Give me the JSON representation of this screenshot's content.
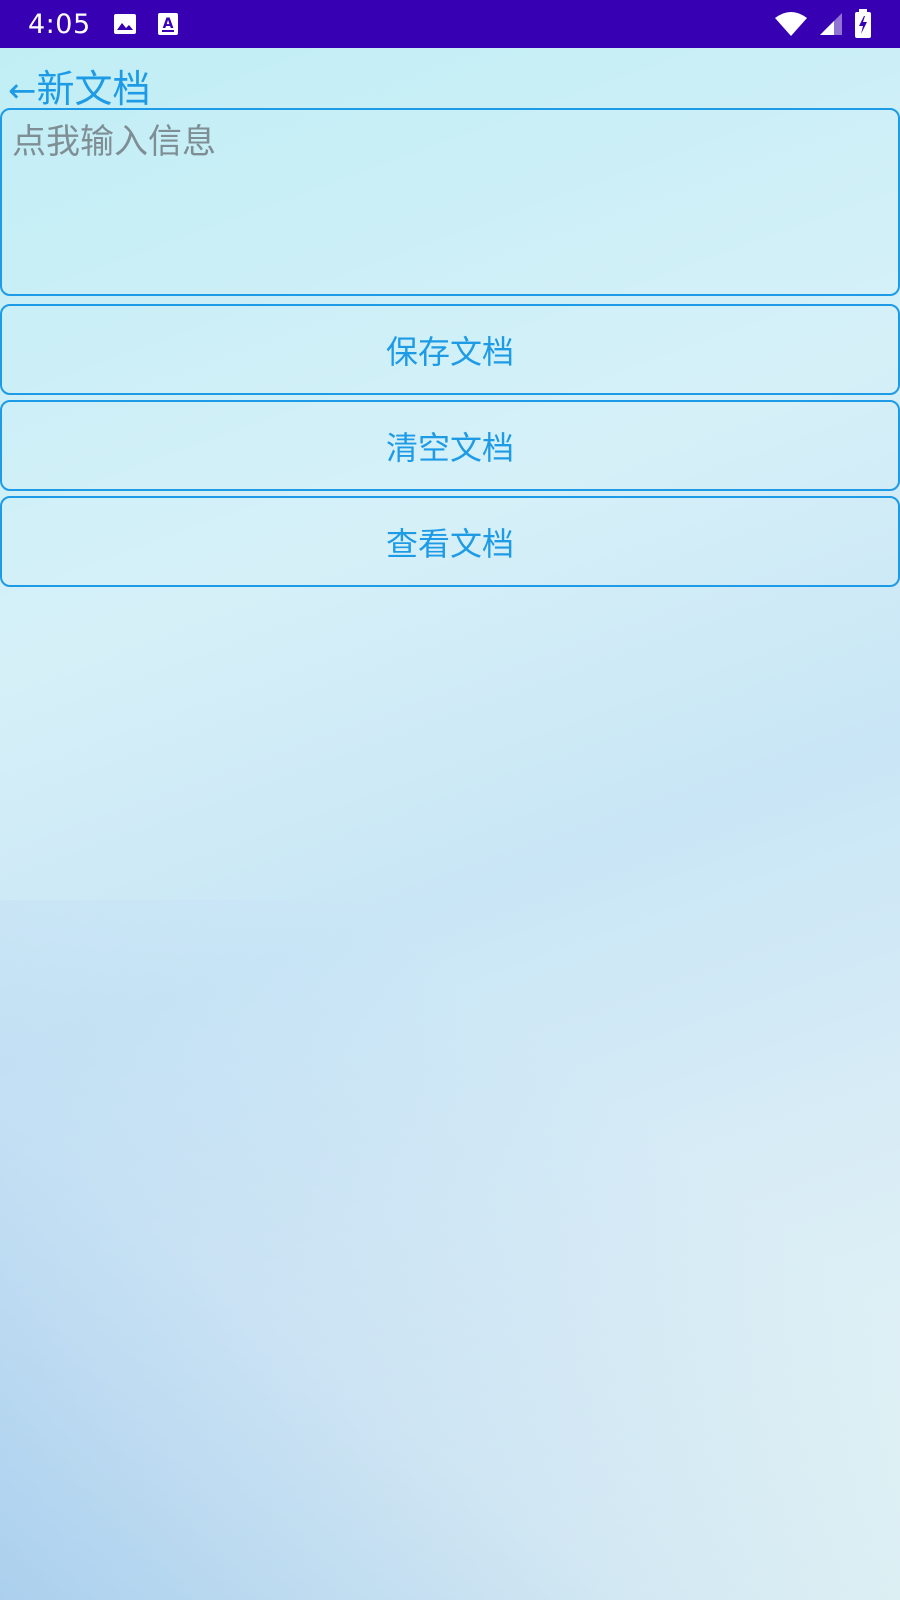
{
  "status_bar": {
    "time": "4:05",
    "background": "#3700b3",
    "left_icons": [
      "image-icon",
      "keyboard-a-icon"
    ],
    "right_icons": [
      "wifi-icon",
      "signal-icon",
      "battery-charging-icon"
    ]
  },
  "header": {
    "back_arrow": "←",
    "title": "新文档"
  },
  "editor": {
    "placeholder": "点我输入信息",
    "value": ""
  },
  "buttons": {
    "save_label": "保存文档",
    "clear_label": "清空文档",
    "view_label": "查看文档"
  },
  "colors": {
    "accent": "#1e9be6",
    "placeholder_text": "#7f8e94"
  }
}
